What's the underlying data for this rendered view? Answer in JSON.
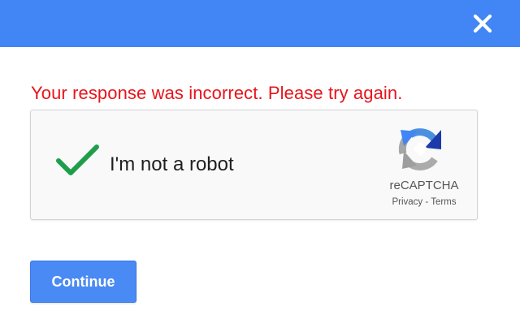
{
  "dialog": {
    "close_icon": "close-icon",
    "accent_color": "#4285f4"
  },
  "error": {
    "message": "Your response was incorrect. Please try again.",
    "color": "#e8141b"
  },
  "captcha": {
    "checkbox_state": "checked",
    "check_color": "#1e9e4a",
    "label": "I'm not a robot",
    "brand_name": "reCAPTCHA",
    "privacy_link": "Privacy",
    "separator": " - ",
    "terms_link": "Terms",
    "logo_icon": "recaptcha-logo-icon"
  },
  "actions": {
    "continue_label": "Continue"
  }
}
